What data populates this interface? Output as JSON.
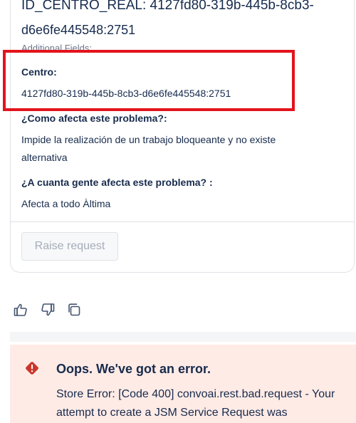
{
  "request": {
    "id_line1": "ID_CENTRO_REAL: 4127fd80-319b-445b-8cb3-",
    "id_line2": "d6e6fe445548:2751",
    "additional_fields_label": "Additional Fields:",
    "fields": [
      {
        "label": "Centro:",
        "value": "4127fd80-319b-445b-8cb3-d6e6fe445548:2751"
      },
      {
        "label": "¿Como afecta este problema?:",
        "value_line1": "Impide la realización de un trabajo bloqueante y no existe",
        "value_line2": "alternativa"
      },
      {
        "label": "¿A cuanta gente afecta este problema? :",
        "value": "Afecta a todo Àltima"
      }
    ],
    "raise_button": "Raise request"
  },
  "feedback": {
    "icons": [
      "thumbs-up-icon",
      "thumbs-down-icon",
      "copy-icon"
    ]
  },
  "error": {
    "title": "Oops. We've got an error.",
    "body": "Store Error: [Code 400] convoai.rest.bad.request - Your attempt to create a JSM Service Request was"
  },
  "colors": {
    "highlight": "#e3131c",
    "error_bg": "#ffebe6",
    "error_icon": "#c9372c",
    "text": "#172b4d",
    "muted": "#6b778c"
  }
}
